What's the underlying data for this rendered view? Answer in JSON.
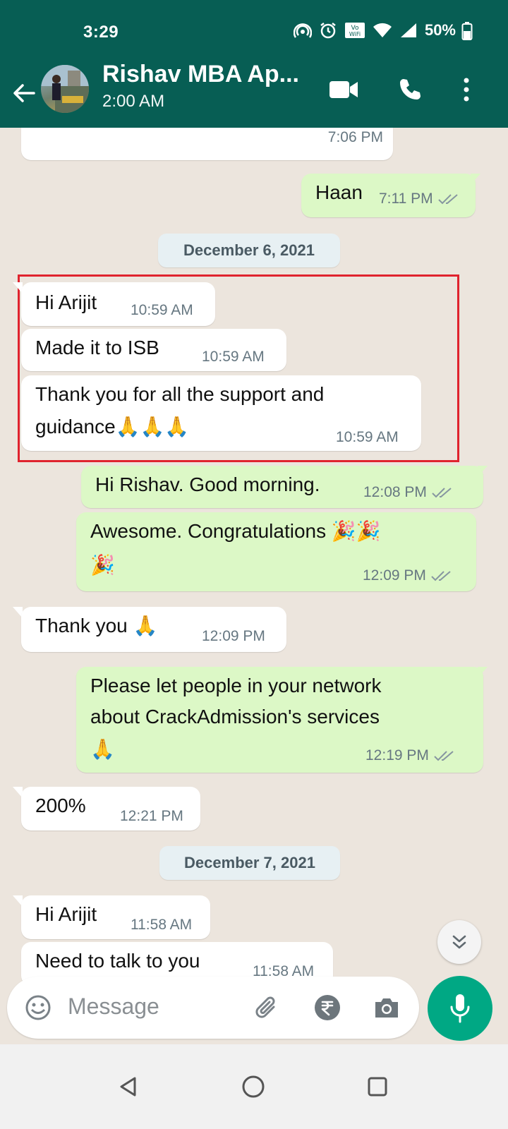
{
  "status_bar": {
    "time": "3:29",
    "battery": "50%"
  },
  "header": {
    "contact_name": "Rishav MBA Ap...",
    "last_seen": "2:00 AM"
  },
  "messages": [
    {
      "dir": "in",
      "text": "",
      "time": "7:06 PM"
    },
    {
      "dir": "out",
      "text": "Haan",
      "time": "7:11 PM"
    },
    {
      "date": "December 6, 2021"
    },
    {
      "dir": "in",
      "text": "Hi Arijit",
      "time": "10:59 AM"
    },
    {
      "dir": "in",
      "text": "Made it to ISB",
      "time": "10:59 AM"
    },
    {
      "dir": "in",
      "text_line1": "Thank you for all the support and",
      "text_line2": "guidance",
      "emoji": "🙏🙏🙏",
      "time": "10:59 AM"
    },
    {
      "dir": "out",
      "text": "Hi Rishav. Good morning.",
      "time": "12:08 PM"
    },
    {
      "dir": "out",
      "text": "Awesome. Congratulations",
      "emoji1": "🎉🎉",
      "emoji2": "🎉",
      "time": "12:09 PM"
    },
    {
      "dir": "in",
      "text": "Thank you",
      "emoji": "🙏",
      "time": "12:09 PM"
    },
    {
      "dir": "out",
      "text_line1": "Please let people in your network",
      "text_line2": "about CrackAdmission's services",
      "emoji": "🙏",
      "time": "12:19 PM"
    },
    {
      "dir": "in",
      "text": "200%",
      "time": "12:21 PM"
    },
    {
      "date": "December 7, 2021"
    },
    {
      "dir": "in",
      "text": "Hi Arijit",
      "time": "11:58 AM"
    },
    {
      "dir": "in",
      "text": "Need to talk to you",
      "time": "11:58 AM"
    }
  ],
  "composer": {
    "placeholder": "Message"
  },
  "icons": {
    "back": "arrow-left-icon",
    "video": "video-call-icon",
    "call": "phone-icon",
    "menu": "more-vert-icon",
    "emoji": "emoji-icon",
    "attach": "paperclip-icon",
    "payment": "rupee-icon",
    "camera": "camera-icon",
    "mic": "mic-icon",
    "scroll_down": "double-chevron-down-icon"
  },
  "colors": {
    "header": "#075E54",
    "outgoing": "#DCF8C6",
    "incoming": "#FFFFFF",
    "accent": "#00A884",
    "highlight": "#E0232E"
  }
}
